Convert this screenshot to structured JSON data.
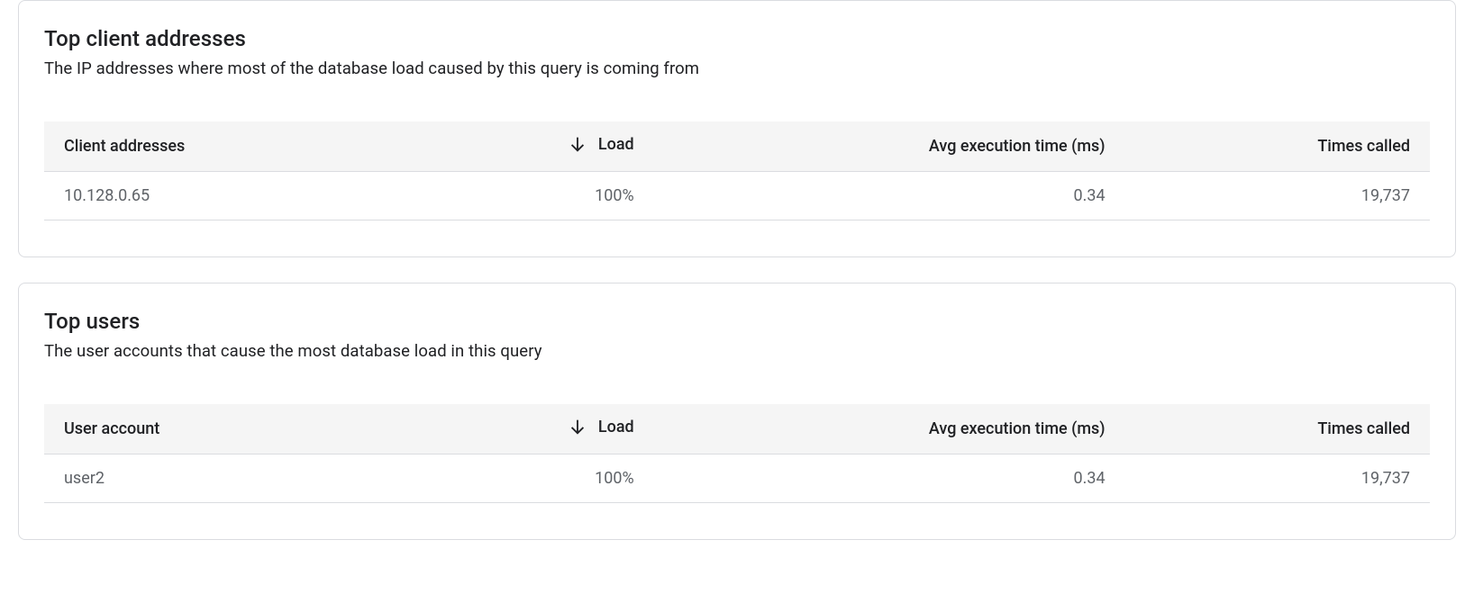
{
  "card1": {
    "title": "Top client addresses",
    "subtitle": "The IP addresses where most of the database load caused by this query is coming from",
    "headers": {
      "col1": "Client addresses",
      "col2": "Load",
      "col3": "Avg execution time (ms)",
      "col4": "Times called"
    },
    "rows": [
      {
        "address": "10.128.0.65",
        "load": "100%",
        "avg": "0.34",
        "times": "19,737"
      }
    ]
  },
  "card2": {
    "title": "Top users",
    "subtitle": "The user accounts that cause the most database load in this query",
    "headers": {
      "col1": "User account",
      "col2": "Load",
      "col3": "Avg execution time (ms)",
      "col4": "Times called"
    },
    "rows": [
      {
        "user": "user2",
        "load": "100%",
        "avg": "0.34",
        "times": "19,737"
      }
    ]
  }
}
